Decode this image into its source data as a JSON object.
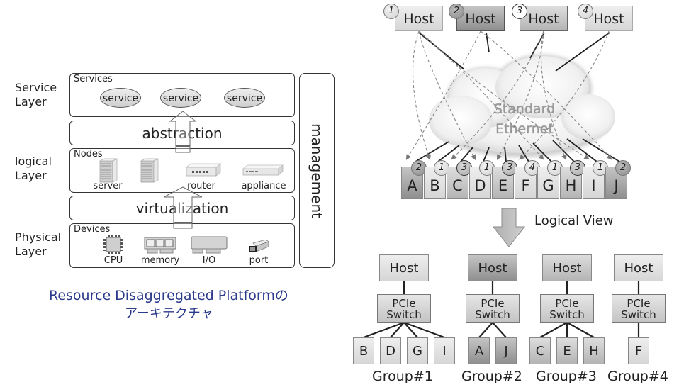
{
  "left_diagram": {
    "layer_labels": {
      "service": [
        "Service",
        "Layer"
      ],
      "logical": [
        "logical",
        "Layer"
      ],
      "physical": [
        "Physical",
        "Layer"
      ]
    },
    "services_panel": {
      "title": "Services",
      "items": [
        "service",
        "service",
        "service"
      ]
    },
    "abstraction_band": "abstraction",
    "nodes_panel": {
      "title": "Nodes",
      "items": [
        "server",
        "",
        "router",
        "appliance"
      ]
    },
    "virtualization_band": "virtualization",
    "devices_panel": {
      "title": "Devices",
      "items": [
        "CPU",
        "memory",
        "I/O",
        "port"
      ]
    },
    "management": "management",
    "caption": [
      "Resource Disaggregated Platformの",
      "アーキテクチャ"
    ]
  },
  "right_diagram": {
    "hosts": [
      {
        "num": "1",
        "label": "Host",
        "shade": "light"
      },
      {
        "num": "2",
        "label": "Host",
        "shade": "dark"
      },
      {
        "num": "3",
        "label": "Host",
        "shade": "mid"
      },
      {
        "num": "4",
        "label": "Host",
        "shade": "light"
      }
    ],
    "cloud_text": [
      "Standard",
      "Ethernet"
    ],
    "devices": [
      {
        "label": "A",
        "assigned": "2",
        "shade": "dark"
      },
      {
        "label": "B",
        "assigned": "1",
        "shade": "light"
      },
      {
        "label": "C",
        "assigned": "3",
        "shade": "mid"
      },
      {
        "label": "D",
        "assigned": "1",
        "shade": "light"
      },
      {
        "label": "E",
        "assigned": "3",
        "shade": "mid"
      },
      {
        "label": "F",
        "assigned": "4",
        "shade": "light"
      },
      {
        "label": "G",
        "assigned": "1",
        "shade": "light"
      },
      {
        "label": "H",
        "assigned": "3",
        "shade": "mid"
      },
      {
        "label": "I",
        "assigned": "1",
        "shade": "light"
      },
      {
        "label": "J",
        "assigned": "2",
        "shade": "dark"
      }
    ],
    "logical_view_label": "Logical View",
    "groups": [
      {
        "name": "Group#1",
        "host": "Host",
        "switch": [
          "PCIe",
          "Switch"
        ],
        "shade": "light",
        "devices": [
          "B",
          "D",
          "G",
          "I"
        ]
      },
      {
        "name": "Group#2",
        "host": "Host",
        "switch": [
          "PCIe",
          "Switch"
        ],
        "shade": "dark",
        "devices": [
          "A",
          "J"
        ]
      },
      {
        "name": "Group#3",
        "host": "Host",
        "switch": [
          "PCIe",
          "Switch"
        ],
        "shade": "mid",
        "devices": [
          "C",
          "E",
          "H"
        ]
      },
      {
        "name": "Group#4",
        "host": "Host",
        "switch": [
          "PCIe",
          "Switch"
        ],
        "shade": "light",
        "devices": [
          "F"
        ]
      }
    ]
  }
}
